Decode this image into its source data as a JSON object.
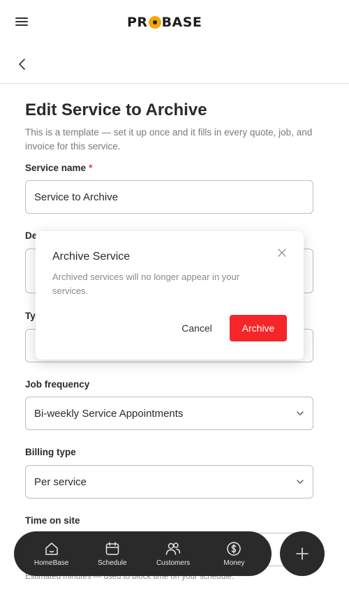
{
  "header": {
    "logo_text_left": "PR",
    "logo_text_right": "BASE",
    "menu_icon": "hamburger-menu-icon",
    "back_icon": "chevron-left-icon"
  },
  "page": {
    "title": "Edit Service to Archive",
    "subtitle": "This is a template — set it up once and it fills in every quote, job, and invoice for this service."
  },
  "form": {
    "service_name_label": "Service name",
    "required_marker": "*",
    "service_name_value": "Service to Archive",
    "description_label": "De",
    "description_value": "",
    "type_label": "Ty",
    "type_value": "",
    "job_frequency_label": "Job frequency",
    "job_frequency_value": "Bi-weekly Service Appointments",
    "billing_type_label": "Billing type",
    "billing_type_value": "Per service",
    "time_on_site_label": "Time on site",
    "time_on_site_helper": "Estimated minutes — used to block time on your schedule."
  },
  "dialog": {
    "title": "Archive Service",
    "message": "Archived services will no longer appear in your services.",
    "cancel_label": "Cancel",
    "archive_label": "Archive"
  },
  "bottom_nav": {
    "items": [
      {
        "label": "HomeBase",
        "icon": "home-icon"
      },
      {
        "label": "Schedule",
        "icon": "calendar-icon"
      },
      {
        "label": "Customers",
        "icon": "customers-icon"
      },
      {
        "label": "Money",
        "icon": "dollar-icon"
      }
    ],
    "fab_icon": "plus-icon"
  },
  "colors": {
    "accent": "#f4262a",
    "nav_bg": "#2a2a2a",
    "logo_accent": "#f2a900"
  }
}
